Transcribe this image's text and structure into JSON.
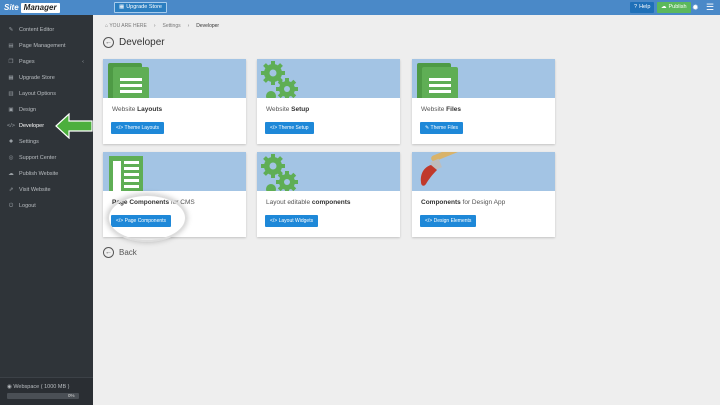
{
  "topbar": {
    "logo_part1": "Site",
    "logo_part2": "Manager",
    "upgrade_label": "Upgrade Store",
    "help_label": "Help",
    "publish_label": "Publish"
  },
  "sidebar": {
    "items": [
      {
        "label": "Content Editor",
        "icon": "pencil-icon"
      },
      {
        "label": "Page Management",
        "icon": "page-icon"
      },
      {
        "label": "Pages",
        "icon": "pages-icon"
      },
      {
        "label": "Upgrade Store",
        "icon": "store-icon"
      },
      {
        "label": "Layout Options",
        "icon": "layout-icon"
      },
      {
        "label": "Design",
        "icon": "image-icon"
      },
      {
        "label": "Developer",
        "icon": "code-icon"
      },
      {
        "label": "Settings",
        "icon": "gear-icon"
      },
      {
        "label": "Support Center",
        "icon": "support-icon"
      },
      {
        "label": "Publish Website",
        "icon": "cloud-upload-icon"
      },
      {
        "label": "Visit Website",
        "icon": "external-link-icon"
      },
      {
        "label": "Logout",
        "icon": "power-icon"
      }
    ],
    "workspace_label": "Webspace ( 1000 MB )",
    "workspace_pct": "0%"
  },
  "breadcrumb": {
    "home": "YOU ARE HERE",
    "settings": "Settings",
    "current": "Developer"
  },
  "page_title": "Developer",
  "cards": [
    {
      "title_pre": "Website ",
      "title_bold": "Layouts",
      "title_post": "",
      "button": "Theme Layouts"
    },
    {
      "title_pre": "Website ",
      "title_bold": "Setup",
      "title_post": "",
      "button": "Theme Setup"
    },
    {
      "title_pre": "Website ",
      "title_bold": "Files",
      "title_post": "",
      "button": "Theme Files"
    },
    {
      "title_pre": "",
      "title_bold": "Page Components",
      "title_post": " for CMS",
      "button": "Page Components"
    },
    {
      "title_pre": "Layout editable ",
      "title_bold": "components",
      "title_post": "",
      "button": "Layout Widgets"
    },
    {
      "title_pre": "",
      "title_bold": "Components",
      "title_post": " for Design App",
      "button": "Design Elements"
    }
  ],
  "back_label": "Back",
  "colors": {
    "topbar": "#4a89c8",
    "sidebar": "#2f3439",
    "banner": "#a3c4e4",
    "button": "#1e88d8",
    "icon_green": "#5fae55",
    "arrow_green": "#4caf3d",
    "publish_green": "#5cb85c"
  }
}
